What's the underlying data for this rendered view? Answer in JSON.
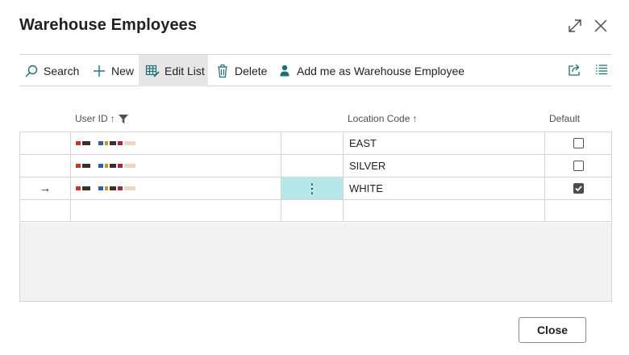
{
  "window": {
    "title": "Warehouse Employees"
  },
  "toolbar": {
    "search_label": "Search",
    "new_label": "New",
    "edit_list_label": "Edit List",
    "delete_label": "Delete",
    "add_me_label": "Add me as Warehouse Employee"
  },
  "columns": {
    "user_id": "User ID",
    "user_id_sort": "↑",
    "location_code": "Location Code",
    "location_code_sort": "↑",
    "default": "Default"
  },
  "rows": [
    {
      "location_code": "EAST",
      "default": false,
      "selected": false
    },
    {
      "location_code": "SILVER",
      "default": false,
      "selected": false
    },
    {
      "location_code": "WHITE",
      "default": true,
      "selected": true
    }
  ],
  "selected_row_marker": "→",
  "row_menu_glyph": "⋮",
  "footer": {
    "close_label": "Close"
  },
  "colors": {
    "selected_cell": "#b6e8ea",
    "accent_icon": "#1f6f78",
    "empty_area": "#f2f2f2"
  },
  "icons": {
    "expand": "expand-icon",
    "close": "close-icon",
    "search": "search-icon",
    "new": "plus-icon",
    "edit_list": "edit-list-icon",
    "delete": "trash-icon",
    "add_me": "person-icon",
    "share": "share-icon",
    "list_view": "list-view-icon",
    "sort": "sort-arrow-icon",
    "filter": "filter-icon"
  }
}
